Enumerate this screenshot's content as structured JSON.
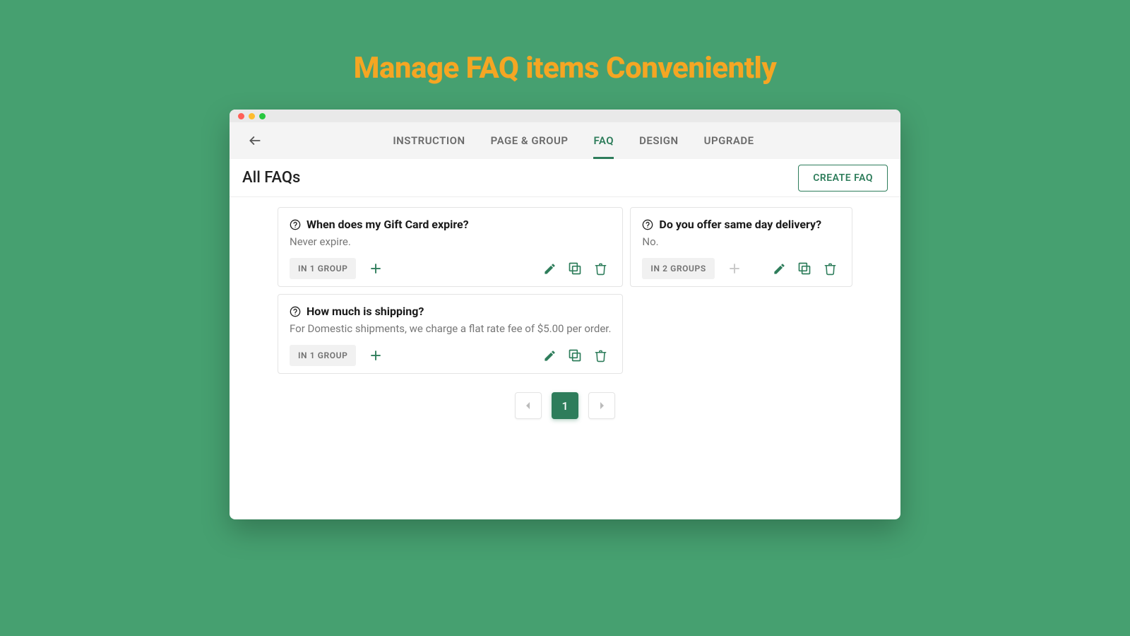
{
  "hero": {
    "title": "Manage FAQ items Conveniently"
  },
  "nav": {
    "tabs": [
      "INSTRUCTION",
      "PAGE & GROUP",
      "FAQ",
      "DESIGN",
      "UPGRADE"
    ],
    "active": "FAQ"
  },
  "page": {
    "title": "All FAQs",
    "create_label": "CREATE FAQ"
  },
  "cards": [
    {
      "question": "When does my Gift Card expire?",
      "answer": "Never expire.",
      "group_label": "IN 1 GROUP",
      "add_disabled": false
    },
    {
      "question": "Do you offer same day delivery?",
      "answer": "No.",
      "group_label": "IN 2 GROUPS",
      "add_disabled": true
    },
    {
      "question": "How much is shipping?",
      "answer": "For Domestic shipments, we charge a flat rate fee of $5.00 per order.",
      "group_label": "IN 1 GROUP",
      "add_disabled": false
    }
  ],
  "pagination": {
    "current": "1"
  },
  "colors": {
    "accent": "#2e7d5b"
  }
}
